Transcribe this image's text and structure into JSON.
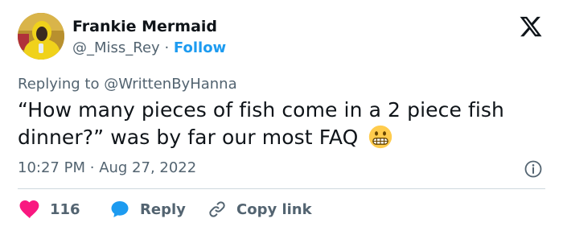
{
  "author": {
    "name": "Frankie Mermaid",
    "handle": "@_Miss_Rey",
    "separator": "·",
    "follow_label": "Follow"
  },
  "platform_logo": "x-logo-icon",
  "reply_to": {
    "prefix": "Replying to",
    "mention": "@WrittenByHanna"
  },
  "tweet": {
    "text": "“How many pieces of fish come in a 2 piece fish dinner?” was by far our most FAQ",
    "emoji": "grimacing-face-emoji"
  },
  "timestamp": {
    "time": "10:27 PM",
    "separator": "·",
    "date": "Aug 27, 2022"
  },
  "actions": {
    "like_count": "116",
    "reply_label": "Reply",
    "copy_link_label": "Copy link"
  },
  "colors": {
    "accent": "#1d9bf0",
    "like": "#f91880",
    "secondary_text": "#536471",
    "primary_text": "#0f1419",
    "divider": "#cfd9de"
  }
}
